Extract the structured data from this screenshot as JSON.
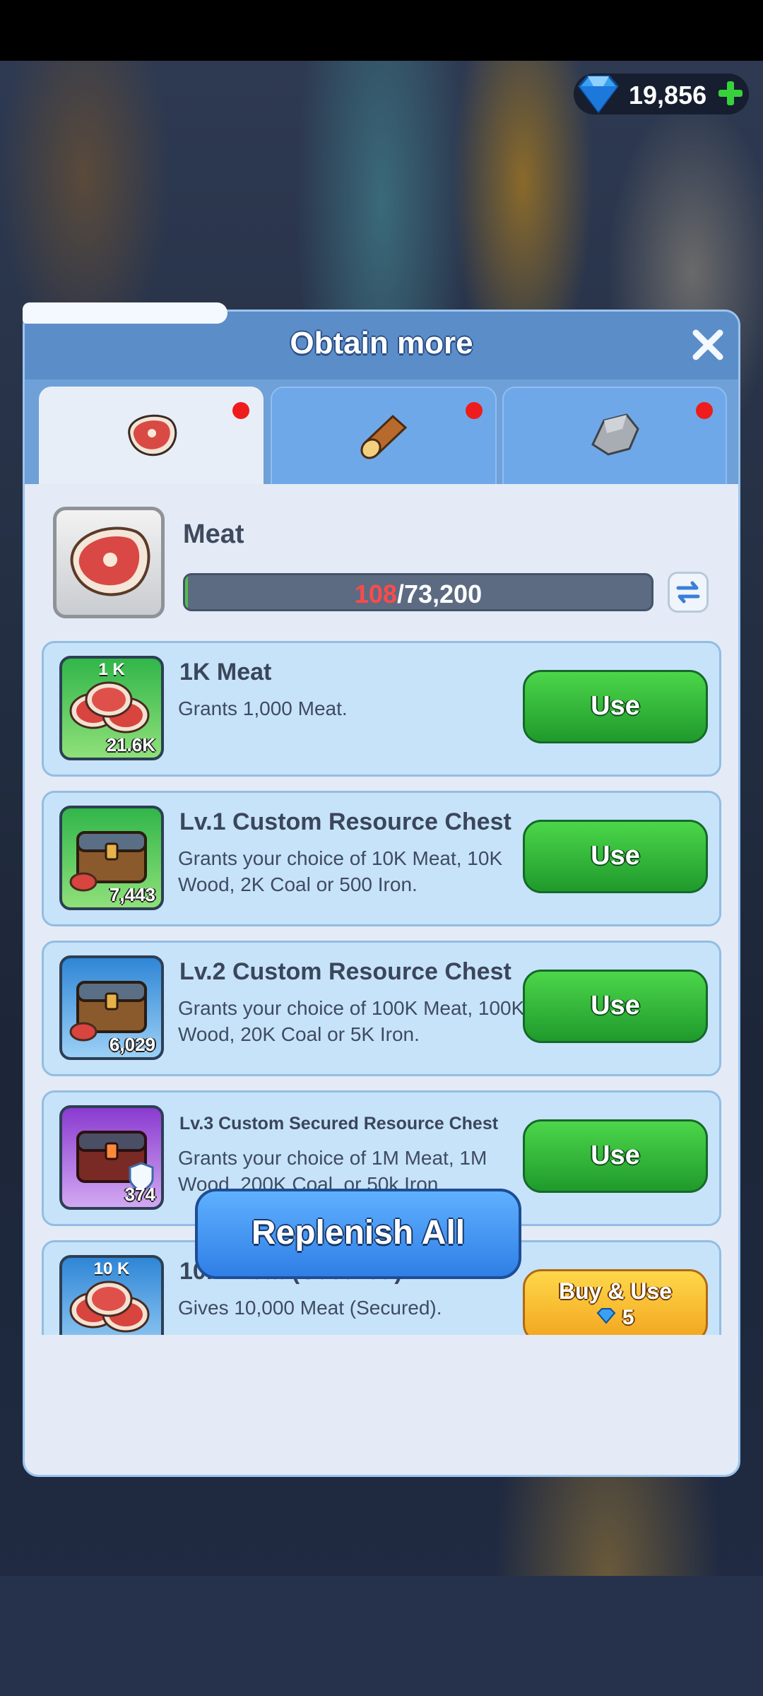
{
  "currency": {
    "value": "19,856",
    "icon": "gem-icon",
    "add_icon": "plus-icon"
  },
  "dialog": {
    "title": "Obtain more",
    "tabs": [
      {
        "icon": "meat-icon",
        "active": true,
        "has_notification": true
      },
      {
        "icon": "wood-icon",
        "active": false,
        "has_notification": true
      },
      {
        "icon": "stone-icon",
        "active": false,
        "has_notification": true
      }
    ],
    "resource": {
      "name": "Meat",
      "current": "108",
      "separator": "/",
      "max": "73,200",
      "fill_fraction": 0.0015
    },
    "items": [
      {
        "title": "1K Meat",
        "thumb_top": "1 K",
        "count": "21.6K",
        "description": "Grants 1,000 Meat.",
        "button": "Use",
        "frame": "green"
      },
      {
        "title": "Lv.1 Custom Resource Chest",
        "thumb_top": "",
        "count": "7,443",
        "description": "Grants your choice of 10K Meat, 10K Wood, 2K Coal or 500 Iron.",
        "button": "Use",
        "frame": "green"
      },
      {
        "title": "Lv.2 Custom Resource Chest",
        "thumb_top": "",
        "count": "6,029",
        "description": "Grants your choice of 100K Meat, 100K Wood, 20K Coal or 5K Iron.",
        "button": "Use",
        "frame": "blue"
      },
      {
        "title": "Lv.3 Custom Secured Resource Chest",
        "thumb_top": "",
        "count": "374",
        "description": "Grants your choice of 1M Meat, 1M Wood, 200K Coal, or 50k Iron",
        "button": "Use",
        "frame": "purple"
      },
      {
        "title": "10K Meat (Secured)",
        "thumb_top": "10 K",
        "count": "",
        "description": "Gives 10,000 Meat (Secured).",
        "button": "Buy & Use",
        "cost": "5",
        "frame": "blue"
      }
    ],
    "replenish_button": "Replenish All"
  },
  "colors": {
    "use_green": "#2fb83b",
    "buy_gold": "#f6b92c",
    "replenish_blue": "#3d8ef0",
    "alert_red": "#ee1c1c"
  }
}
